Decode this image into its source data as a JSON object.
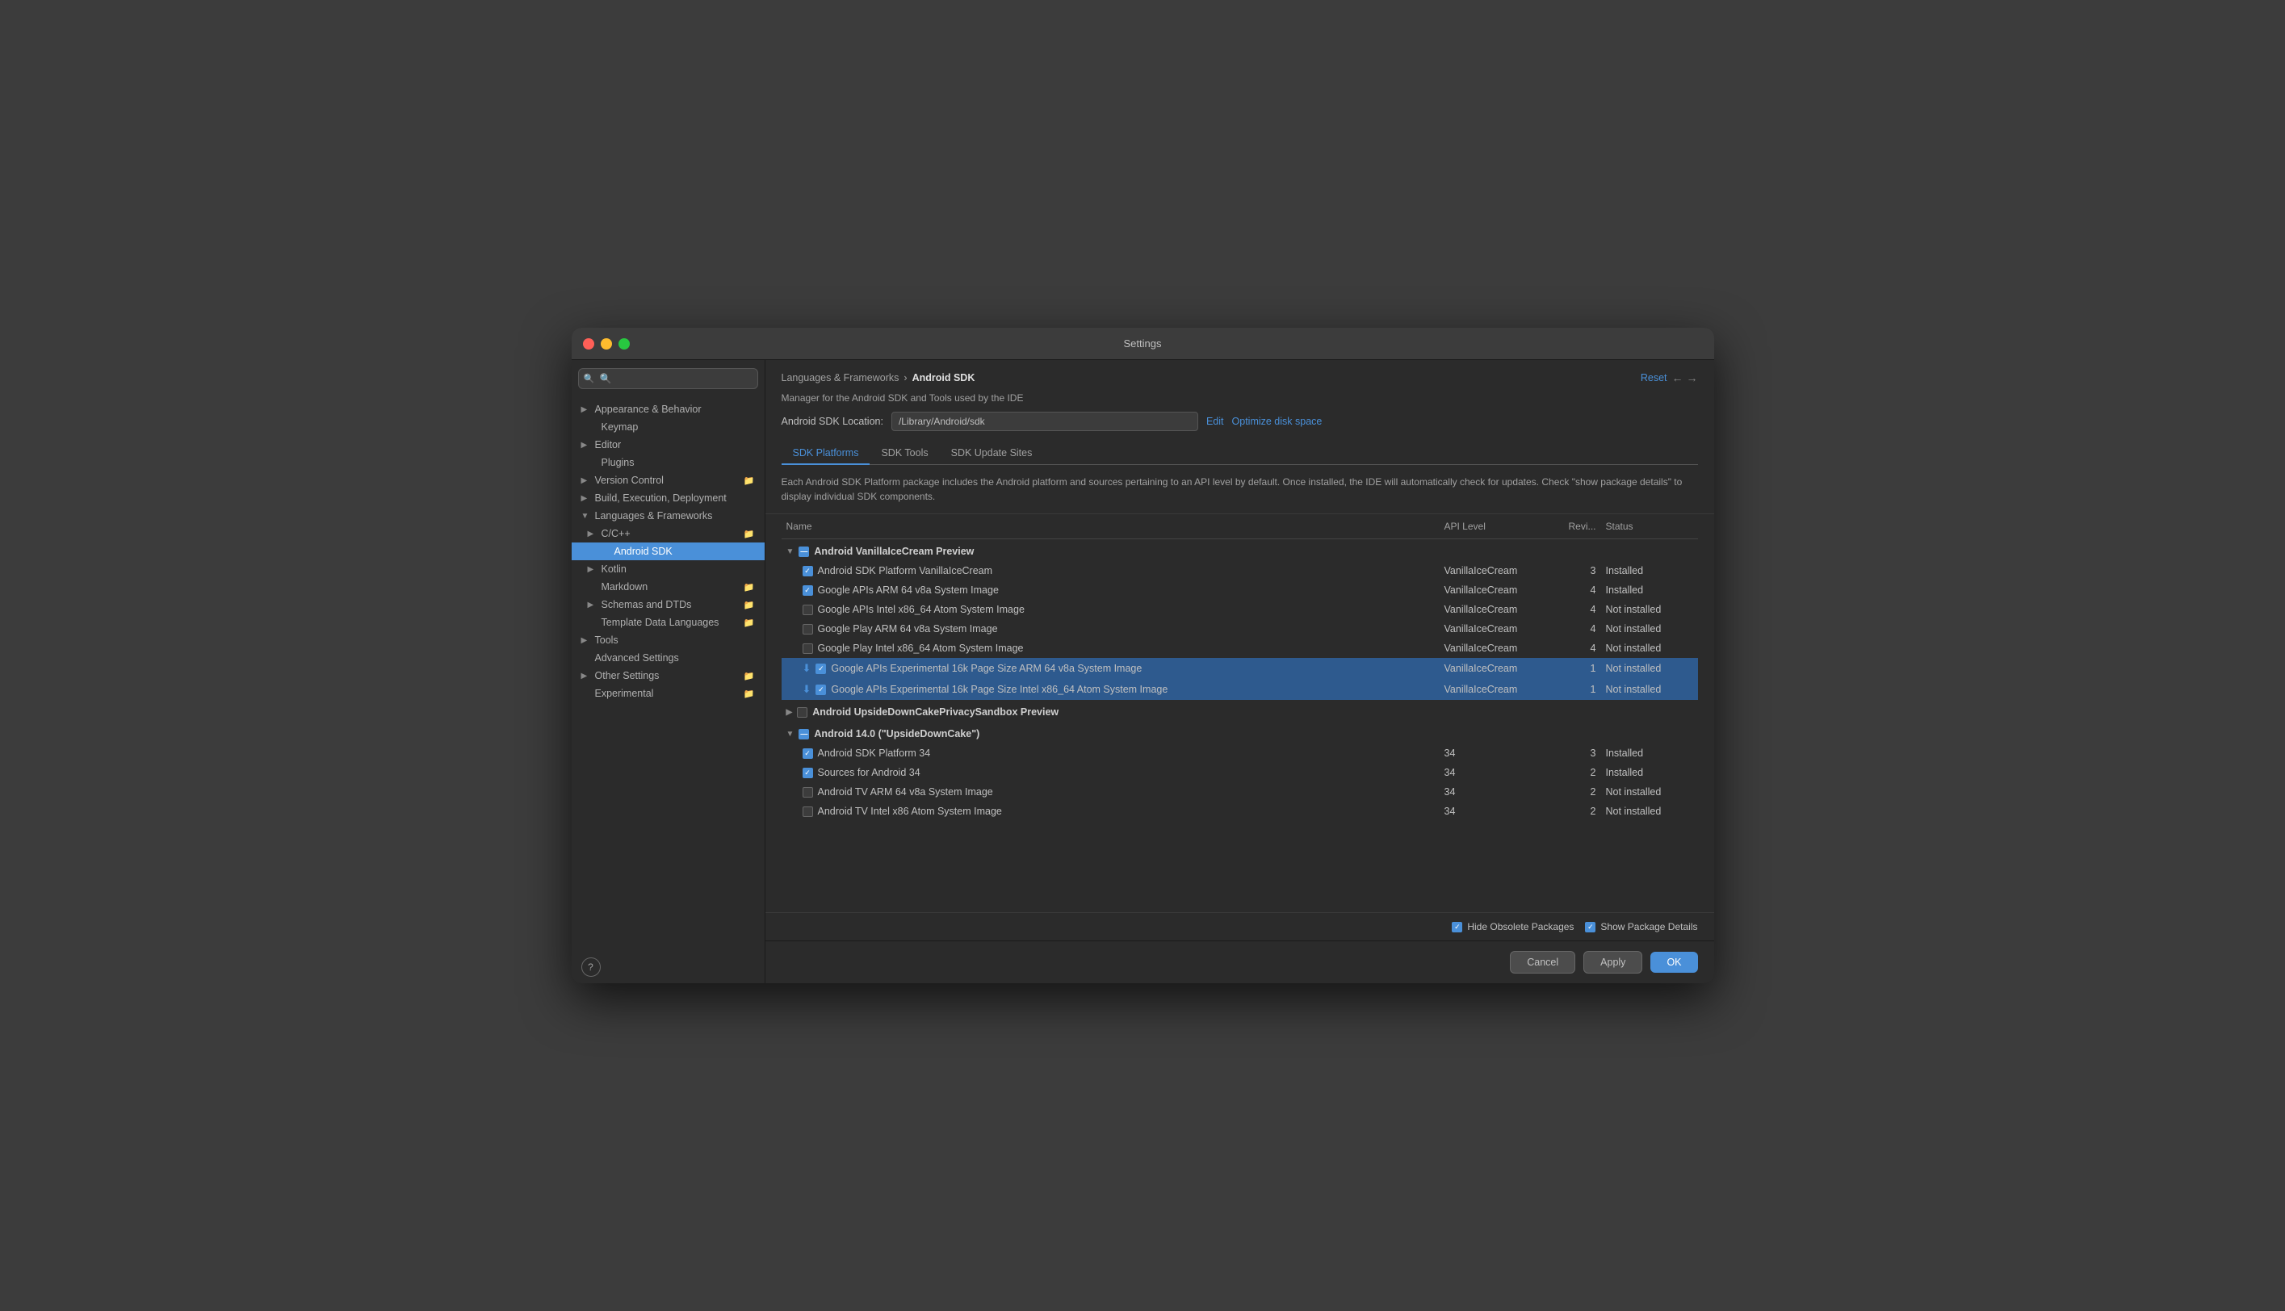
{
  "window": {
    "title": "Settings"
  },
  "sidebar": {
    "search_placeholder": "🔍",
    "items": [
      {
        "id": "appearance",
        "label": "Appearance & Behavior",
        "level": 0,
        "expandable": true,
        "expanded": false,
        "has_icon": false
      },
      {
        "id": "keymap",
        "label": "Keymap",
        "level": 0,
        "expandable": false
      },
      {
        "id": "editor",
        "label": "Editor",
        "level": 0,
        "expandable": true,
        "expanded": false
      },
      {
        "id": "plugins",
        "label": "Plugins",
        "level": 0,
        "expandable": false
      },
      {
        "id": "version-control",
        "label": "Version Control",
        "level": 0,
        "expandable": true,
        "has_icon": true
      },
      {
        "id": "build-execution",
        "label": "Build, Execution, Deployment",
        "level": 0,
        "expandable": true,
        "has_icon": false
      },
      {
        "id": "languages-frameworks",
        "label": "Languages & Frameworks",
        "level": 0,
        "expandable": true,
        "expanded": true
      },
      {
        "id": "cpp",
        "label": "C/C++",
        "level": 1,
        "expandable": true,
        "has_icon": true
      },
      {
        "id": "android-sdk",
        "label": "Android SDK",
        "level": 2,
        "expandable": false,
        "selected": true
      },
      {
        "id": "kotlin",
        "label": "Kotlin",
        "level": 1,
        "expandable": true
      },
      {
        "id": "markdown",
        "label": "Markdown",
        "level": 1,
        "expandable": false,
        "has_icon": true
      },
      {
        "id": "schemas-dtds",
        "label": "Schemas and DTDs",
        "level": 1,
        "expandable": true,
        "has_icon": true
      },
      {
        "id": "template-data",
        "label": "Template Data Languages",
        "level": 1,
        "expandable": false,
        "has_icon": true
      },
      {
        "id": "tools",
        "label": "Tools",
        "level": 0,
        "expandable": true
      },
      {
        "id": "advanced-settings",
        "label": "Advanced Settings",
        "level": 0,
        "expandable": false
      },
      {
        "id": "other-settings",
        "label": "Other Settings",
        "level": 0,
        "expandable": true,
        "has_icon": true
      },
      {
        "id": "experimental",
        "label": "Experimental",
        "level": 0,
        "expandable": false,
        "has_icon": true
      }
    ]
  },
  "main": {
    "breadcrumb_parent": "Languages & Frameworks",
    "breadcrumb_current": "Android SDK",
    "reset_label": "Reset",
    "description": "Manager for the Android SDK and Tools used by the IDE",
    "sdk_location_label": "Android SDK Location:",
    "sdk_location_value": "/Library/Android/sdk",
    "edit_label": "Edit",
    "optimize_label": "Optimize disk space",
    "tabs": [
      {
        "id": "sdk-platforms",
        "label": "SDK Platforms",
        "active": true
      },
      {
        "id": "sdk-tools",
        "label": "SDK Tools",
        "active": false
      },
      {
        "id": "sdk-update-sites",
        "label": "SDK Update Sites",
        "active": false
      }
    ],
    "tab_description": "Each Android SDK Platform package includes the Android platform and sources pertaining to an API level by default. Once installed, the IDE will automatically check for updates. Check \"show package details\" to display individual SDK components.",
    "table": {
      "headers": [
        "Name",
        "API Level",
        "Revi...",
        "Status"
      ],
      "rows": [
        {
          "type": "group-header",
          "expanded": true,
          "checkbox": "blue",
          "name": "Android VanillaIceCream Preview",
          "api": "",
          "rev": "",
          "status": "",
          "level": 0
        },
        {
          "type": "item",
          "checkbox": "checked",
          "name": "Android SDK Platform VanillaIceCream",
          "api": "VanillaIceCream",
          "rev": "3",
          "status": "Installed",
          "level": 1
        },
        {
          "type": "item",
          "checkbox": "checked",
          "name": "Google APIs ARM 64 v8a System Image",
          "api": "VanillaIceCream",
          "rev": "4",
          "status": "Installed",
          "level": 1
        },
        {
          "type": "item",
          "checkbox": "unchecked",
          "name": "Google APIs Intel x86_64 Atom System Image",
          "api": "VanillaIceCream",
          "rev": "4",
          "status": "Not installed",
          "level": 1
        },
        {
          "type": "item",
          "checkbox": "unchecked",
          "name": "Google Play ARM 64 v8a System Image",
          "api": "VanillaIceCream",
          "rev": "4",
          "status": "Not installed",
          "level": 1
        },
        {
          "type": "item",
          "checkbox": "unchecked",
          "name": "Google Play Intel x86_64 Atom System Image",
          "api": "VanillaIceCream",
          "rev": "4",
          "status": "Not installed",
          "level": 1
        },
        {
          "type": "item",
          "checkbox": "checked",
          "name": "Google APIs Experimental 16k Page Size ARM 64 v8a System Image",
          "api": "VanillaIceCream",
          "rev": "1",
          "status": "Not installed",
          "level": 1,
          "selected": true,
          "download": true
        },
        {
          "type": "item",
          "checkbox": "checked",
          "name": "Google APIs Experimental 16k Page Size Intel x86_64 Atom System Image",
          "api": "VanillaIceCream",
          "rev": "1",
          "status": "Not installed",
          "level": 1,
          "selected": true,
          "download": true
        },
        {
          "type": "group-header",
          "expanded": false,
          "checkbox": "unchecked",
          "name": "Android UpsideDownCakePrivacySandbox Preview",
          "api": "",
          "rev": "",
          "status": "",
          "level": 0
        },
        {
          "type": "group-header",
          "expanded": true,
          "checkbox": "blue",
          "name": "Android 14.0 (\"UpsideDownCake\")",
          "api": "",
          "rev": "",
          "status": "",
          "level": 0
        },
        {
          "type": "item",
          "checkbox": "checked",
          "name": "Android SDK Platform 34",
          "api": "34",
          "rev": "3",
          "status": "Installed",
          "level": 1
        },
        {
          "type": "item",
          "checkbox": "checked",
          "name": "Sources for Android 34",
          "api": "34",
          "rev": "2",
          "status": "Installed",
          "level": 1
        },
        {
          "type": "item",
          "checkbox": "unchecked",
          "name": "Android TV ARM 64 v8a System Image",
          "api": "34",
          "rev": "2",
          "status": "Not installed",
          "level": 1
        },
        {
          "type": "item",
          "checkbox": "unchecked",
          "name": "Android TV Intel x86 Atom System Image",
          "api": "34",
          "rev": "2",
          "status": "Not installed",
          "level": 1
        }
      ]
    },
    "footer": {
      "hide_obsolete_label": "Hide Obsolete Packages",
      "show_package_label": "Show Package Details",
      "hide_obsolete_checked": true,
      "show_package_checked": true
    },
    "buttons": {
      "cancel": "Cancel",
      "apply": "Apply",
      "ok": "OK"
    }
  }
}
